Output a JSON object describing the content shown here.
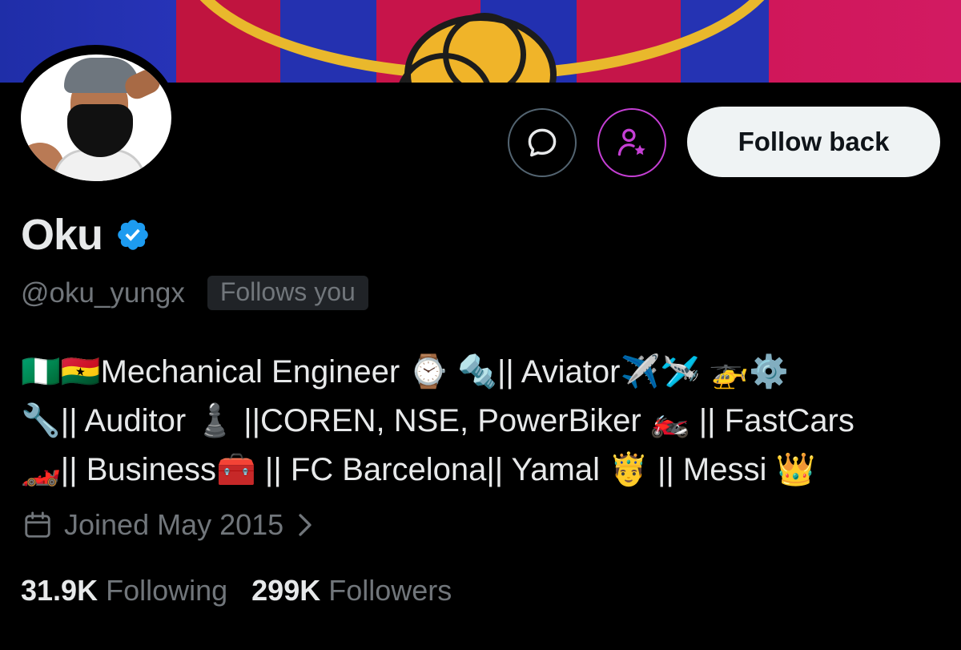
{
  "banner": {
    "colors": {
      "blue": "#2230b0",
      "red": "#c7144a",
      "gold": "#e9b82c"
    }
  },
  "avatar": {
    "alt": "profile avatar"
  },
  "actions": {
    "message_icon": "message-bubble-icon",
    "subscribe_icon": "person-star-icon",
    "follow_label": "Follow back"
  },
  "profile": {
    "name": "Oku",
    "verified_icon": "verified-badge-icon",
    "handle": "@oku_yungx",
    "follows_you": "Follows you",
    "bio_lines": [
      "🇳🇬🇬🇭Mechanical Engineer ⌚ 🔩|| Aviator✈️🛩️ 🚁⚙️",
      "🔧|| Auditor ♟️ ||COREN, NSE, PowerBiker 🏍️ || FastCars",
      "🏎️|| Business🧰 || FC Barcelona|| Yamal 🤴 || Messi 👑"
    ],
    "joined": "Joined May 2015",
    "following_count": "31.9K",
    "following_label": "Following",
    "followers_count": "299K",
    "followers_label": "Followers"
  },
  "colors": {
    "accent_verified": "#1d9bf0",
    "subscribe_ring": "#c53fd4",
    "muted": "#71767b"
  }
}
